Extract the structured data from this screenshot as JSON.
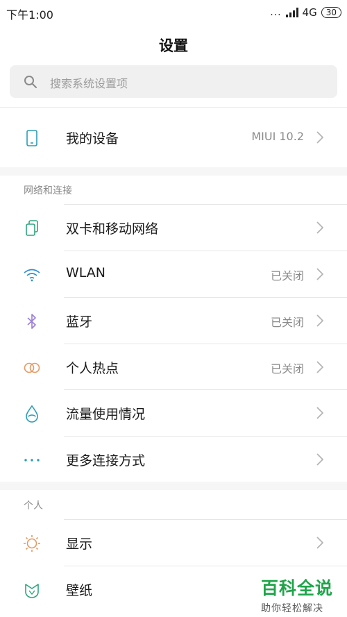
{
  "status_bar": {
    "time": "下午1:00",
    "dots": "...",
    "network": "4G",
    "battery": "30"
  },
  "title": "设置",
  "search": {
    "placeholder": "搜索系统设置项"
  },
  "device_row": {
    "label": "我的设备",
    "value": "MIUI 10.2"
  },
  "sections": {
    "network": {
      "header": "网络和连接",
      "items": [
        {
          "label": "双卡和移动网络",
          "value": ""
        },
        {
          "label": "WLAN",
          "value": "已关闭"
        },
        {
          "label": "蓝牙",
          "value": "已关闭"
        },
        {
          "label": "个人热点",
          "value": "已关闭"
        },
        {
          "label": "流量使用情况",
          "value": ""
        },
        {
          "label": "更多连接方式",
          "value": ""
        }
      ]
    },
    "personal": {
      "header": "个人",
      "items": [
        {
          "label": "显示",
          "value": ""
        },
        {
          "label": "壁纸",
          "value": ""
        }
      ]
    }
  },
  "watermark": {
    "title": "百科全说",
    "subtitle": "助你轻松解决"
  },
  "colors": {
    "icon_teal": "#2a9db7",
    "icon_purple": "#9b7fd6",
    "icon_orange": "#e59a63",
    "icon_blue": "#2f8fcf",
    "icon_green": "#2fa57d",
    "watermark_green": "#1fa44a"
  }
}
